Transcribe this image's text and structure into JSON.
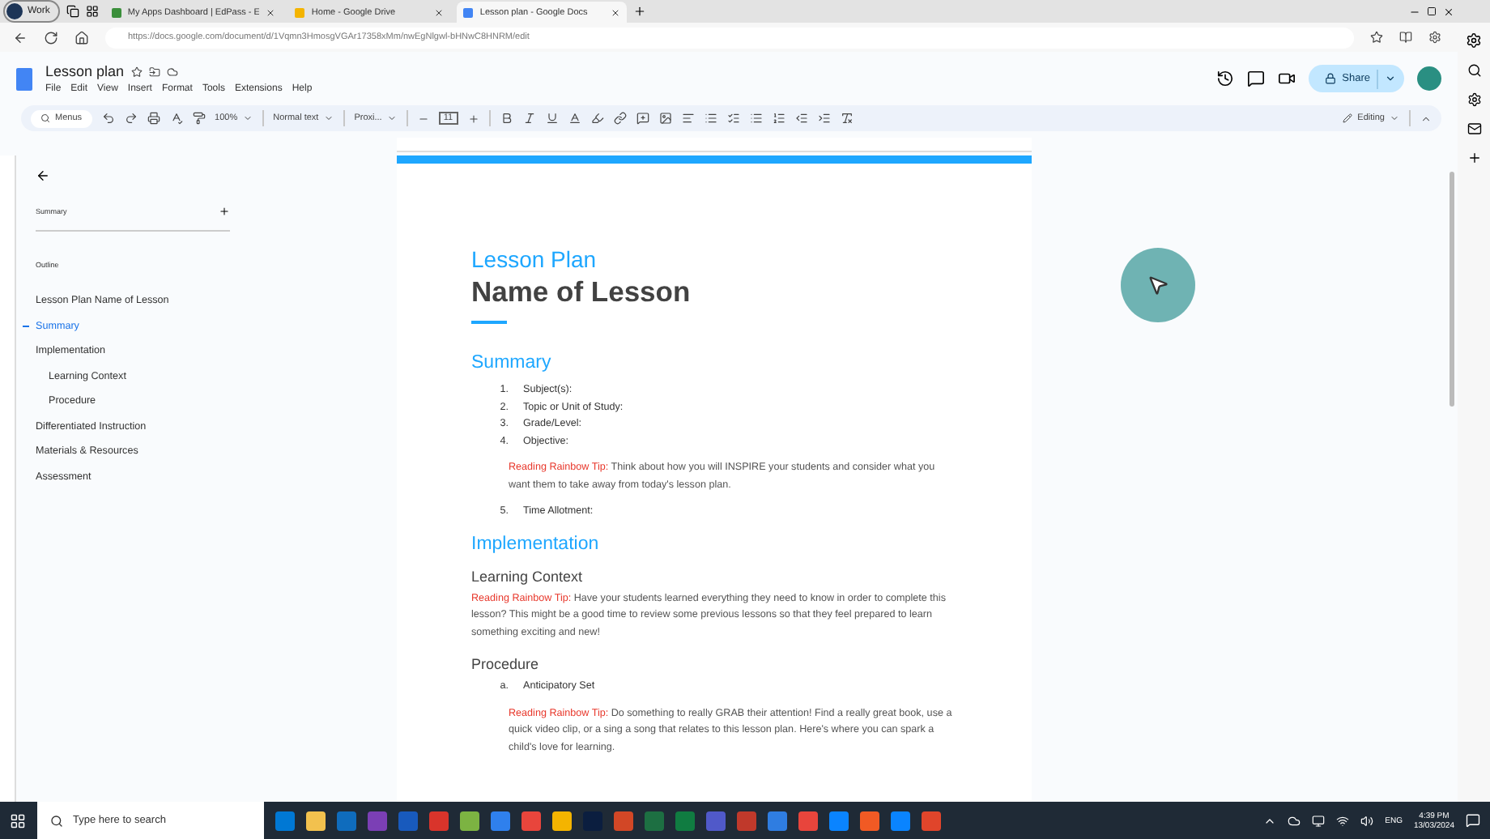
{
  "browser": {
    "profile": "Work",
    "tabs": [
      {
        "title": "My Apps Dashboard | EdPass - E",
        "selected": false,
        "color": "#3b8f3b"
      },
      {
        "title": "Home - Google Drive",
        "selected": false,
        "color": "#f4b400"
      },
      {
        "title": "Lesson plan - Google Docs",
        "selected": true,
        "color": "#4285f4"
      }
    ],
    "url": "https://docs.google.com/document/d/1Vqmn3HmosgVGAr17358xMm/nwEgNlgwl-bHNwC8HNRM/edit"
  },
  "docs": {
    "title": "Lesson plan",
    "menu": [
      "File",
      "Edit",
      "View",
      "Insert",
      "Format",
      "Tools",
      "Extensions",
      "Help"
    ],
    "share": "Share",
    "toolbar": {
      "search": "Menus",
      "zoom": "100%",
      "style": "Normal text",
      "font": "Proxi...",
      "size": "11",
      "mode": "Editing"
    }
  },
  "outline": {
    "summary_label": "Summary",
    "outline_label": "Outline",
    "items": [
      {
        "label": "Lesson Plan Name of Lesson",
        "selected": false
      },
      {
        "label": "Summary",
        "selected": true
      },
      {
        "label": "Implementation",
        "selected": false,
        "children": [
          {
            "label": "Learning Context",
            "selected": false
          },
          {
            "label": "Procedure",
            "selected": false
          }
        ]
      },
      {
        "label": "Differentiated Instruction",
        "selected": false
      },
      {
        "label": "Materials & Resources",
        "selected": false
      },
      {
        "label": "Assessment",
        "selected": false
      }
    ]
  },
  "document": {
    "heading": "Lesson Plan",
    "title": "Name of Lesson",
    "blocks": [
      {
        "kind": "h1",
        "text": "Summary"
      },
      {
        "kind": "item",
        "number": "1.",
        "text": "Subject(s):"
      },
      {
        "kind": "item",
        "number": "2.",
        "text": "Topic or Unit of Study:"
      },
      {
        "kind": "item",
        "number": "3.",
        "text": "Grade/Level:"
      },
      {
        "kind": "item",
        "number": "4.",
        "text": "Objective:"
      },
      {
        "kind": "tip",
        "indented": true,
        "label": "Reading Rainbow Tip:",
        "text": "Think about how you will INSPIRE your students and consider what you want them to take away from today's lesson plan."
      },
      {
        "kind": "item",
        "number": "5.",
        "text": "Time Allotment:"
      },
      {
        "kind": "h1",
        "text": "Implementation"
      },
      {
        "kind": "h2",
        "text": "Learning Context"
      },
      {
        "kind": "tip",
        "indented": false,
        "label": "Reading Rainbow Tip:",
        "text": "Have your students learned everything they need to know in order to complete this lesson? This might be a good time to review some previous lessons so that they feel prepared to learn something exciting and new!"
      },
      {
        "kind": "h2",
        "text": "Procedure"
      },
      {
        "kind": "item",
        "number": "a.",
        "text": "Anticipatory Set"
      },
      {
        "kind": "tip",
        "indented": true,
        "label": "Reading Rainbow Tip:",
        "text": "Do something to really GRAB their attention! Find a really great book, use a quick video clip, or a sing a song that relates to this lesson plan. Here's where you can spark a child's love for learning."
      }
    ]
  },
  "taskbar": {
    "search": "Type here to search",
    "language": "ENG",
    "time": "4:39 PM",
    "date": "13/03/2024"
  }
}
